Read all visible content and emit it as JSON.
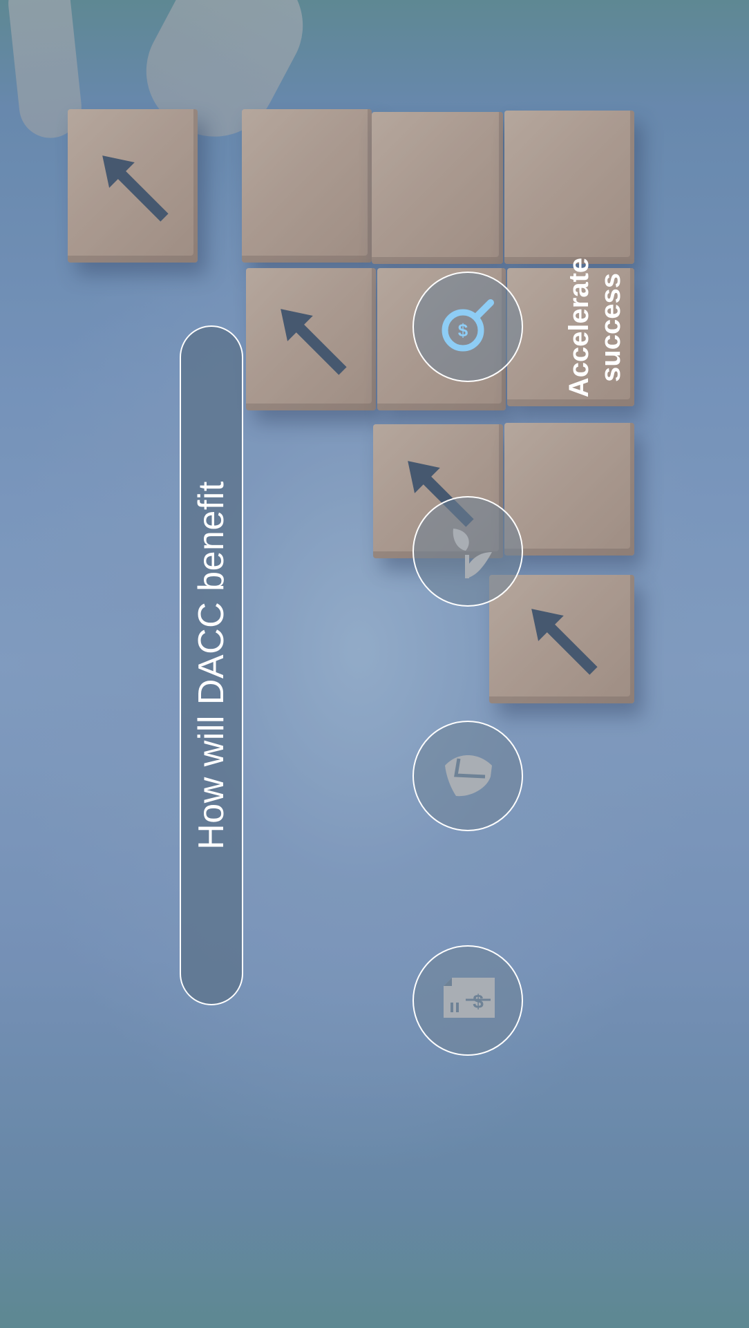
{
  "question": "How will DACC benefit",
  "benefit_label": [
    "Accelerate",
    "success"
  ],
  "icons": [
    "dollar-magnifier-icon",
    "leaf-sprout-icon",
    "shield-icon",
    "invoice-dollar-icon"
  ],
  "colors": {
    "accent": "#8ecdf5",
    "muted_icon": "#a9aeb4",
    "pill_fill": "#5c738c",
    "text": "#ffffff"
  }
}
